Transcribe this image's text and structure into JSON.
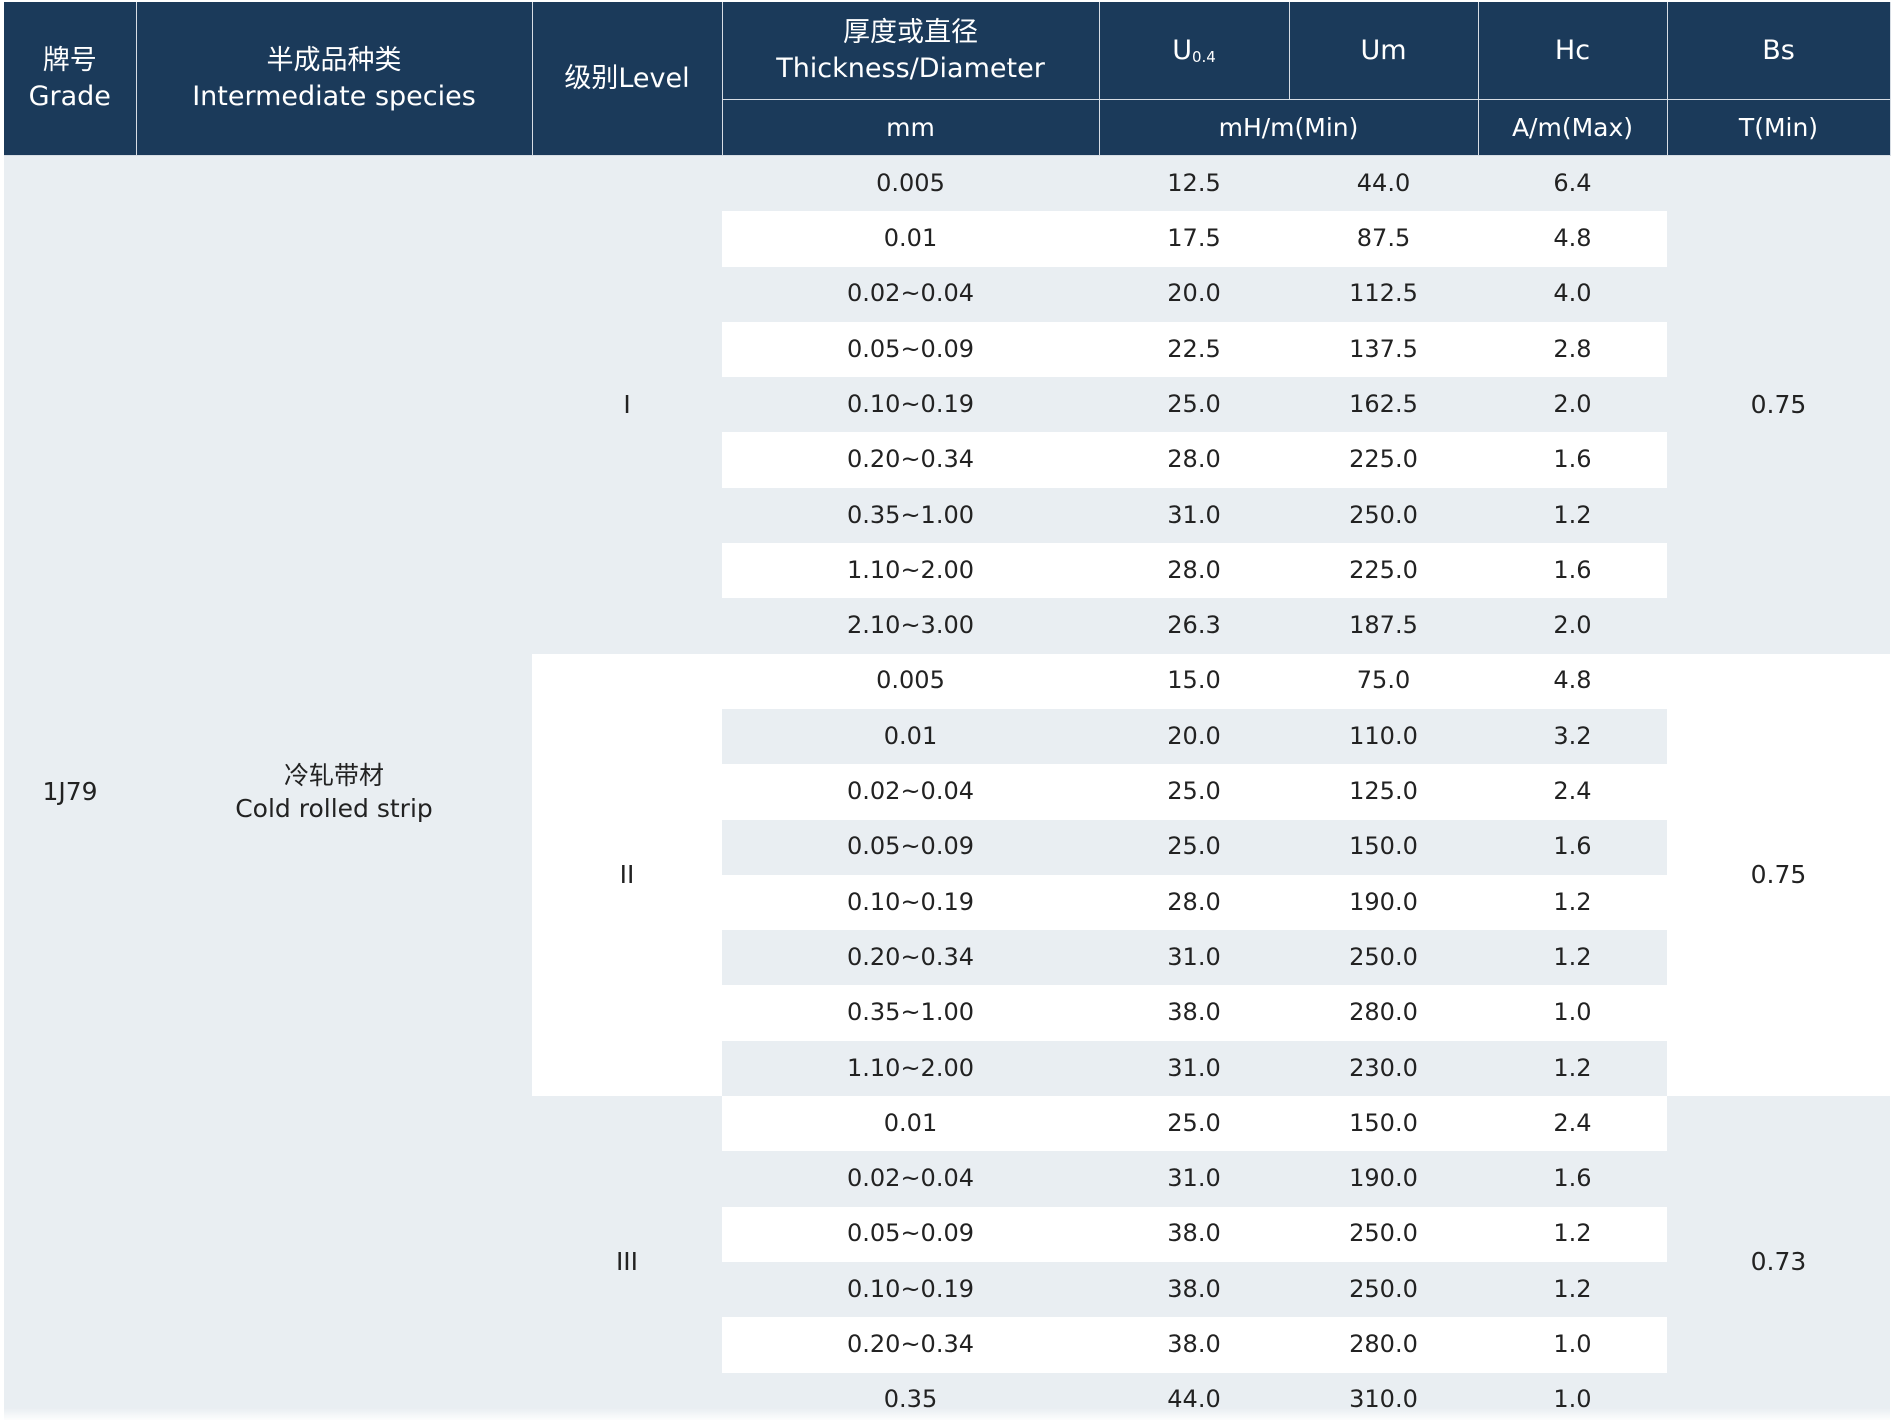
{
  "header": {
    "grade": {
      "zh": "牌号",
      "en": "Grade"
    },
    "species": {
      "zh": "半成品种类",
      "en": "Intermediate species"
    },
    "level": "级别Level",
    "thickness": {
      "zh": "厚度或直径",
      "en": "Thickness/Diameter"
    },
    "u04": {
      "base": "U",
      "sub": "0.4"
    },
    "um": "Um",
    "hc": "Hc",
    "bs": "Bs",
    "units": {
      "thickness": "mm",
      "permeability": "mH/m(Min)",
      "hc": "A/m(Max)",
      "bs": "T(Min)"
    }
  },
  "grade": "1J79",
  "species": {
    "zh": "冷轧带材",
    "en": "Cold rolled strip"
  },
  "groups": [
    {
      "level": "I",
      "bs": "0.75",
      "rows": [
        {
          "thickness": "0.005",
          "u04": "12.5",
          "um": "44.0",
          "hc": "6.4"
        },
        {
          "thickness": "0.01",
          "u04": "17.5",
          "um": "87.5",
          "hc": "4.8"
        },
        {
          "thickness": "0.02~0.04",
          "u04": "20.0",
          "um": "112.5",
          "hc": "4.0"
        },
        {
          "thickness": "0.05~0.09",
          "u04": "22.5",
          "um": "137.5",
          "hc": "2.8"
        },
        {
          "thickness": "0.10~0.19",
          "u04": "25.0",
          "um": "162.5",
          "hc": "2.0"
        },
        {
          "thickness": "0.20~0.34",
          "u04": "28.0",
          "um": "225.0",
          "hc": "1.6"
        },
        {
          "thickness": "0.35~1.00",
          "u04": "31.0",
          "um": "250.0",
          "hc": "1.2"
        },
        {
          "thickness": "1.10~2.00",
          "u04": "28.0",
          "um": "225.0",
          "hc": "1.6"
        },
        {
          "thickness": "2.10~3.00",
          "u04": "26.3",
          "um": "187.5",
          "hc": "2.0"
        }
      ]
    },
    {
      "level": "II",
      "bs": "0.75",
      "rows": [
        {
          "thickness": "0.005",
          "u04": "15.0",
          "um": "75.0",
          "hc": "4.8"
        },
        {
          "thickness": "0.01",
          "u04": "20.0",
          "um": "110.0",
          "hc": "3.2"
        },
        {
          "thickness": "0.02~0.04",
          "u04": "25.0",
          "um": "125.0",
          "hc": "2.4"
        },
        {
          "thickness": "0.05~0.09",
          "u04": "25.0",
          "um": "150.0",
          "hc": "1.6"
        },
        {
          "thickness": "0.10~0.19",
          "u04": "28.0",
          "um": "190.0",
          "hc": "1.2"
        },
        {
          "thickness": "0.20~0.34",
          "u04": "31.0",
          "um": "250.0",
          "hc": "1.2"
        },
        {
          "thickness": "0.35~1.00",
          "u04": "38.0",
          "um": "280.0",
          "hc": "1.0"
        },
        {
          "thickness": "1.10~2.00",
          "u04": "31.0",
          "um": "230.0",
          "hc": "1.2"
        }
      ]
    },
    {
      "level": "III",
      "bs": "0.73",
      "rows": [
        {
          "thickness": "0.01",
          "u04": "25.0",
          "um": "150.0",
          "hc": "2.4"
        },
        {
          "thickness": "0.02~0.04",
          "u04": "31.0",
          "um": "190.0",
          "hc": "1.6"
        },
        {
          "thickness": "0.05~0.09",
          "u04": "38.0",
          "um": "250.0",
          "hc": "1.2"
        },
        {
          "thickness": "0.10~0.19",
          "u04": "38.0",
          "um": "250.0",
          "hc": "1.2"
        },
        {
          "thickness": "0.20~0.34",
          "u04": "38.0",
          "um": "280.0",
          "hc": "1.0"
        },
        {
          "thickness": "0.35",
          "u04": "44.0",
          "um": "310.0",
          "hc": "1.0"
        }
      ]
    }
  ]
}
